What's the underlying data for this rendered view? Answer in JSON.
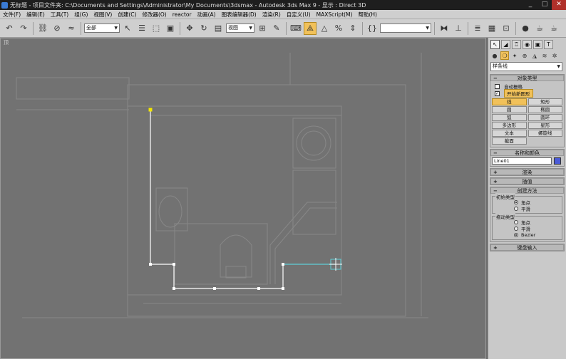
{
  "window": {
    "title": "无标题  - 项目文件夹: C:\\Documents and Settings\\Administrator\\My Documents\\3dsmax    - Autodesk 3ds Max 9         - 显示 : Direct 3D",
    "controls": [
      "_",
      "□",
      "✕"
    ]
  },
  "menu": [
    "文件(F)",
    "编辑(E)",
    "工具(T)",
    "组(G)",
    "视图(V)",
    "创建(C)",
    "修改器(O)",
    "reactor",
    "动画(A)",
    "图表编辑器(D)",
    "渲染(R)",
    "自定义(U)",
    "MAXScript(M)",
    "帮助(H)"
  ],
  "toolbar": {
    "selection_filter": "全部",
    "ref_coord": "视图",
    "named_selection": ""
  },
  "viewport": {
    "label": "顶"
  },
  "command_panel": {
    "shape_type_dropdown": "样条线",
    "object_type": {
      "title": "对象类型",
      "autogrid_label": "自动栅格",
      "start_new_shape_label": "开始新图形",
      "start_new_shape_checked": true,
      "buttons": [
        "线",
        "矩形",
        "圆",
        "椭圆",
        "弧",
        "圆环",
        "多边形",
        "星形",
        "文本",
        "螺旋线",
        "截面"
      ],
      "active_button": "线"
    },
    "name_color": {
      "title": "名称和颜色",
      "name": "Line01",
      "color": "#4b5bd8"
    },
    "rollouts_collapsed": [
      "渲染",
      "插值"
    ],
    "creation_method": {
      "title": "创建方法",
      "initial_type": {
        "title": "初始类型",
        "options": [
          "角点",
          "平滑"
        ],
        "selected": "角点"
      },
      "drag_type": {
        "title": "拖动类型",
        "options": [
          "角点",
          "平滑",
          "Bezier"
        ],
        "selected": "Bezier"
      }
    },
    "keyboard_entry": "键盘输入"
  },
  "colors": {
    "viewport_bg": "#727272",
    "spline": "#ffffff",
    "active_segment": "#5fd0d8",
    "vertex_first": "#f2e600",
    "accent": "#f1c15a"
  }
}
